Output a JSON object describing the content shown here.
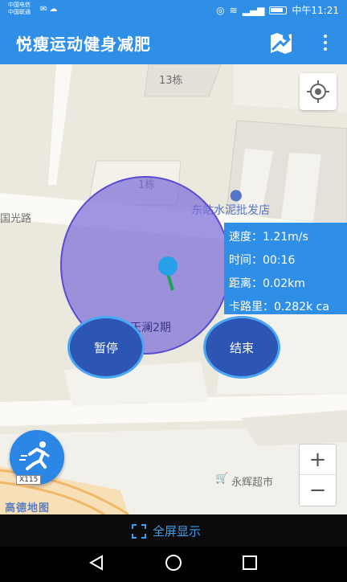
{
  "status_bar": {
    "carrier_1": "中国电信",
    "carrier_2": "中国联通",
    "time": "中午11:21"
  },
  "app_bar": {
    "title": "悦瘦运动健身减肥",
    "map_icon": "map-route-icon",
    "more_icon": "more-vert-icon"
  },
  "map": {
    "labels": {
      "building_13": "13栋",
      "building_1": "1栋",
      "road": "国光路",
      "poi_cement": "东站水泥批发店",
      "poi_tianlan": "天澜2期",
      "poi_supermarket": "永辉超市",
      "road_tag": "X115",
      "amap_logo": "高德地图"
    },
    "locate_icon": "locate-icon",
    "zoom_in": "+",
    "zoom_out": "−"
  },
  "stats": {
    "speed": "速度：1.21m/s",
    "time": "时间：00:16",
    "distance": "距离：0.02km",
    "calories": "卡路里：0.282k ca"
  },
  "controls": {
    "pause_label": "暂停",
    "end_label": "结束",
    "run_icon": "running-person-icon"
  },
  "bottom": {
    "fullscreen_label": "全屏显示",
    "fullscreen_icon": "fullscreen-icon"
  },
  "colors": {
    "primary": "#2f8ee6",
    "range_fill": "#7b6ed7",
    "button_fill": "#2d56b4"
  }
}
